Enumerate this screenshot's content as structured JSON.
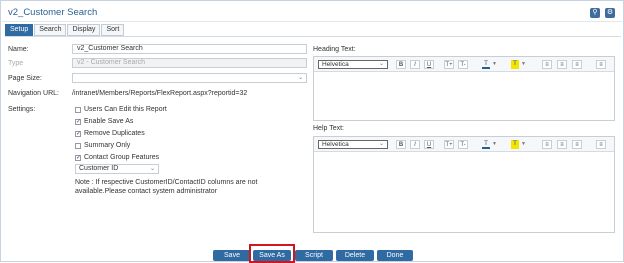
{
  "window": {
    "title": "v2_Customer Search"
  },
  "tabs": [
    "Setup",
    "Search",
    "Display",
    "Sort"
  ],
  "form": {
    "name_label": "Name:",
    "name_value": "v2_Customer Search",
    "type_label": "Type",
    "type_value": "v2 - Customer Search",
    "pagesize_label": "Page Size:",
    "navurl_label": "Navigation URL:",
    "navurl_value": "/intranet/Members/Reports/FlexReport.aspx?reportid=32",
    "settings_label": "Settings:",
    "settings": [
      {
        "label": "Users Can Edit this Report",
        "checked": false
      },
      {
        "label": "Enable Save As",
        "checked": true
      },
      {
        "label": "Remove Duplicates",
        "checked": true
      },
      {
        "label": "Summary Only",
        "checked": false
      },
      {
        "label": "Contact Group Features",
        "checked": true
      }
    ],
    "group_select": "Customer ID",
    "note": "Note : If respective CustomerID/ContactID columns are not available.Please contact system administrator"
  },
  "heading_editor": {
    "label": "Heading Text:",
    "font": "Helvetica"
  },
  "help_editor": {
    "label": "Help Text:",
    "font": "Helvetica"
  },
  "toolbar": {
    "bold": "B",
    "italic": "I",
    "underline": "U",
    "superscript": "T+",
    "subscript": "T-",
    "text_color": "T",
    "highlight": "T"
  },
  "buttons": {
    "save": "Save",
    "save_as": "Save As",
    "script": "Script",
    "delete": "Delete",
    "done": "Done"
  },
  "colors": {
    "primary": "#2f6aa3",
    "highlight_box": "#d2161e",
    "title": "#2a5f95"
  }
}
